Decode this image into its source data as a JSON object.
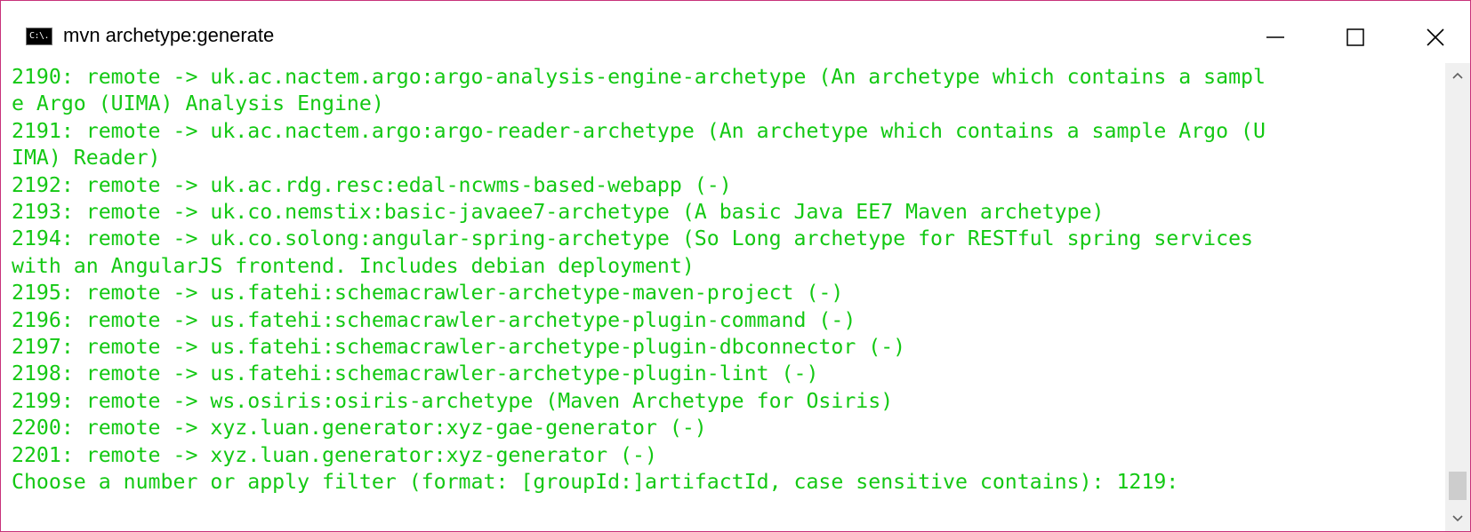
{
  "window": {
    "title": "mvn  archetype:generate",
    "icon_label": "C:\\.",
    "icon": "console-icon",
    "controls": {
      "minimize_icon": "minimize-icon",
      "maximize_icon": "maximize-icon",
      "close_icon": "close-icon"
    }
  },
  "console": {
    "text_color": "#13c813",
    "background": "#ffffff",
    "lines": [
      "2190: remote -> uk.ac.nactem.argo:argo-analysis-engine-archetype (An archetype which contains a sampl",
      "e Argo (UIMA) Analysis Engine)",
      "2191: remote -> uk.ac.nactem.argo:argo-reader-archetype (An archetype which contains a sample Argo (U",
      "IMA) Reader)",
      "2192: remote -> uk.ac.rdg.resc:edal-ncwms-based-webapp (-)",
      "2193: remote -> uk.co.nemstix:basic-javaee7-archetype (A basic Java EE7 Maven archetype)",
      "2194: remote -> uk.co.solong:angular-spring-archetype (So Long archetype for RESTful spring services",
      "with an AngularJS frontend. Includes debian deployment)",
      "2195: remote -> us.fatehi:schemacrawler-archetype-maven-project (-)",
      "2196: remote -> us.fatehi:schemacrawler-archetype-plugin-command (-)",
      "2197: remote -> us.fatehi:schemacrawler-archetype-plugin-dbconnector (-)",
      "2198: remote -> us.fatehi:schemacrawler-archetype-plugin-lint (-)",
      "2199: remote -> ws.osiris:osiris-archetype (Maven Archetype for Osiris)",
      "2200: remote -> xyz.luan.generator:xyz-gae-generator (-)",
      "2201: remote -> xyz.luan.generator:xyz-generator (-)",
      "Choose a number or apply filter (format: [groupId:]artifactId, case sensitive contains): 1219:"
    ]
  },
  "scrollbar": {
    "position_fraction": 0.985,
    "up_icon": "scroll-up-arrow-icon",
    "down_icon": "scroll-down-arrow-icon"
  }
}
